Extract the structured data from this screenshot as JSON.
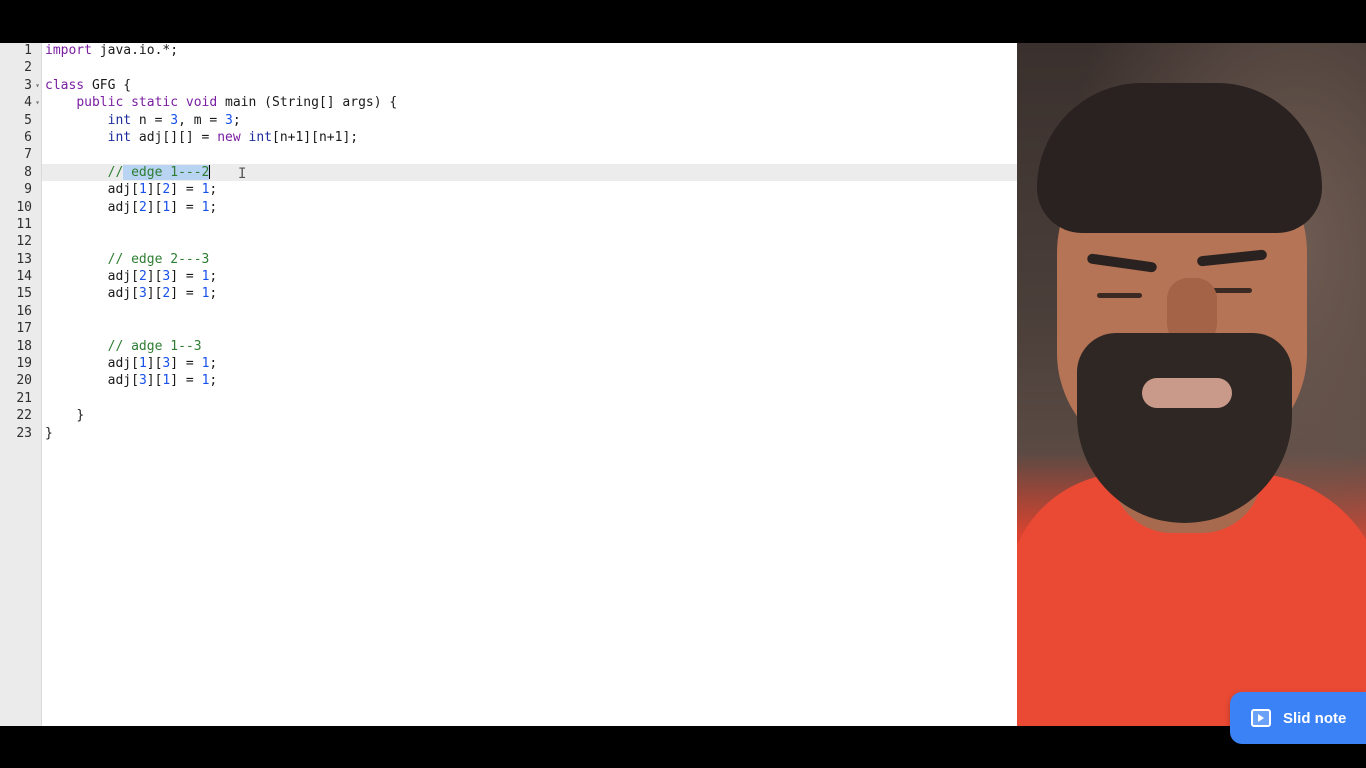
{
  "editor": {
    "line_numbers": [
      "1",
      "2",
      "3",
      "4",
      "5",
      "6",
      "7",
      "8",
      "9",
      "10",
      "11",
      "12",
      "13",
      "14",
      "15",
      "16",
      "17",
      "18",
      "19",
      "20",
      "21",
      "22",
      "23"
    ],
    "code": {
      "l1": {
        "kw": "import",
        "rest": " java.io.*;"
      },
      "l3": {
        "kw": "class",
        "rest": " GFG {"
      },
      "l4": {
        "kw": "public static void",
        "rest": " main (String[] args) {"
      },
      "l5": {
        "kw": "int",
        "a": " n = ",
        "n1": "3",
        "b": ", m = ",
        "n2": "3",
        "c": ";"
      },
      "l6": {
        "kw": "int",
        "a": " adj[][] = ",
        "kw_new": "new",
        "kw_int": " int",
        "b": "[n+1][n+1];"
      },
      "l8": {
        "prefix": "//",
        "selected": " edge 1---2"
      },
      "l9": {
        "a": "adj[",
        "i": "1",
        "b": "][",
        "j": "2",
        "c": "] = ",
        "v": "1",
        "d": ";"
      },
      "l10": {
        "a": "adj[",
        "i": "2",
        "b": "][",
        "j": "1",
        "c": "] = ",
        "v": "1",
        "d": ";"
      },
      "l13": "// edge 2---3",
      "l14": {
        "a": "adj[",
        "i": "2",
        "b": "][",
        "j": "3",
        "c": "] = ",
        "v": "1",
        "d": ";"
      },
      "l15": {
        "a": "adj[",
        "i": "3",
        "b": "][",
        "j": "2",
        "c": "] = ",
        "v": "1",
        "d": ";"
      },
      "l18": "// adge 1--3",
      "l19": {
        "a": "adj[",
        "i": "1",
        "b": "][",
        "j": "3",
        "c": "] = ",
        "v": "1",
        "d": ";"
      },
      "l20": {
        "a": "adj[",
        "i": "3",
        "b": "][",
        "j": "1",
        "c": "] = ",
        "v": "1",
        "d": ";"
      },
      "l22": "}",
      "l23": "}"
    },
    "active_line": "8"
  },
  "slid_note": {
    "label": "Slid note",
    "color": "#3b82f6",
    "icon": "play-note-icon"
  },
  "webcam": {
    "shirt_color": "#ea4a34"
  }
}
